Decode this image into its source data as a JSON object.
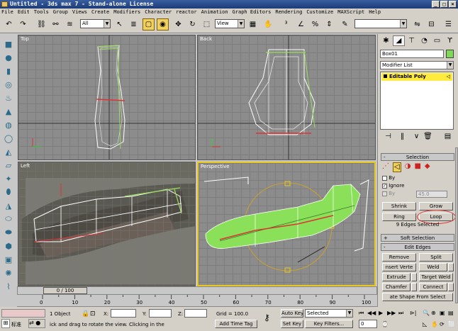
{
  "window": {
    "title": "Untitled - 3ds max 7  - Stand-alone License"
  },
  "menu": [
    "File",
    "Edit",
    "Tools",
    "Group",
    "Views",
    "Create",
    "Modifiers",
    "Character",
    "reactor",
    "Animation",
    "Graph Editors",
    "Rendering",
    "Customize",
    "MAXScript",
    "Help"
  ],
  "toolbar": {
    "selection_filter": "All",
    "ref_coord": "View"
  },
  "viewports": {
    "top": "Top",
    "back": "Back",
    "left": "Left",
    "perspective": "Perspective"
  },
  "timeline": {
    "frame_display": "0 / 100",
    "ticks": [
      "0",
      "10",
      "20",
      "30",
      "40",
      "50",
      "60",
      "70",
      "80",
      "90",
      "100"
    ]
  },
  "status": {
    "selection_info": "1 Object",
    "x_label": "X:",
    "y_label": "Y:",
    "z_label": "Z:",
    "grid": "Grid = 100.0",
    "auto_key": "Auto Key",
    "key_mode": "Selected",
    "set_key": "Set Key",
    "key_filters": "Key Filters...",
    "prompt": "ick and drag to rotate the view.  Clicking in the",
    "add_time_tag": "Add Time Tag",
    "frame_field": "0",
    "ime": "标准"
  },
  "command_panel": {
    "object_name": "Box01",
    "object_color": "#7ed957",
    "modifier_list": "Modifier List",
    "stack_item": "Editable Poly",
    "selection_rollout": "Selection",
    "by_vertex": "By",
    "ignore_backfacing": "Ignore",
    "by_angle": "By",
    "angle_value": "45.0",
    "shrink": "Shrink",
    "grow": "Grow",
    "ring": "Ring",
    "loop": "Loop",
    "selection_status": "9 Edges Selected",
    "soft_selection": "Soft Selection",
    "edit_edges": "Edit Edges",
    "remove": "Remove",
    "split": "Split",
    "insert_vertex": "nsert Verte",
    "weld": "Weld",
    "extrude": "Extrude",
    "target_weld": "Target Weld",
    "chamfer": "Chamfer",
    "connect": "Connect",
    "create_shape": "ate Shape From Select"
  }
}
